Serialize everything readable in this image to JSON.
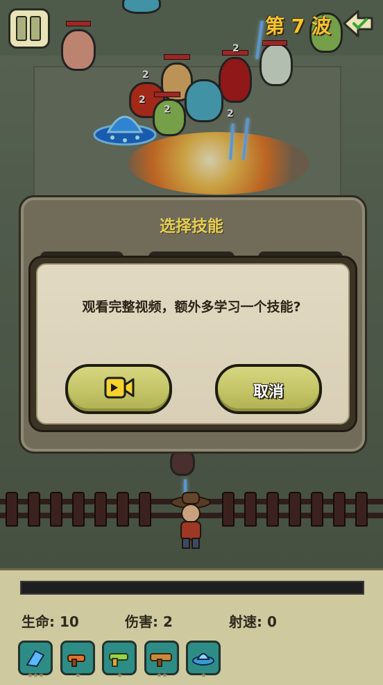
{
  "hud_top": {
    "wave_text": "第 7 波"
  },
  "panel": {
    "title": "选择技能"
  },
  "dialog": {
    "message": "观看完整视频，额外多学习一个技能?",
    "cancel_label": "取消"
  },
  "enemy_hp_labels": [
    "2",
    "2",
    "2",
    "2",
    "2"
  ],
  "stats": {
    "hp": "生命: 10",
    "damage": "伤害: 2",
    "fire_rate": "射速: 0"
  },
  "skills": [
    {
      "name": "crystal-gun-icon",
      "stars": "★★★"
    },
    {
      "name": "flame-gun-icon",
      "stars": "★"
    },
    {
      "name": "blaster-gun-icon",
      "stars": "★"
    },
    {
      "name": "bazooka-icon",
      "stars": "★★"
    },
    {
      "name": "ufo-icon",
      "stars": "★"
    }
  ],
  "colors": {
    "wave": "#f2c431",
    "panel_title": "#e5cf55",
    "button": "#c3c466",
    "skill_bg": "#2e8c86"
  }
}
